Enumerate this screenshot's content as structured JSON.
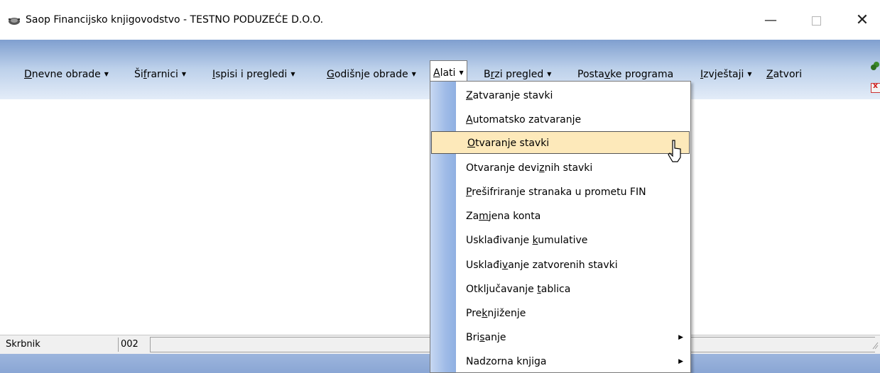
{
  "window": {
    "title": "Saop Financijsko knjigovodstvo - TESTNO PODUZEĆE D.O.O.",
    "min_glyph": "—",
    "close_glyph": "✕"
  },
  "menubar": {
    "caret": "▼",
    "items": [
      {
        "pre": "",
        "u": "D",
        "post": "nevne obrade",
        "has_caret": true
      },
      {
        "pre": "Ši",
        "u": "f",
        "post": "rarnici",
        "has_caret": true
      },
      {
        "pre": "",
        "u": "I",
        "post": "spisi i pregledi",
        "has_caret": true
      },
      {
        "pre": "",
        "u": "G",
        "post": "odišnje obrade",
        "has_caret": true
      },
      {
        "pre": "",
        "u": "A",
        "post": "lati",
        "has_caret": true
      },
      {
        "pre": "B",
        "u": "r",
        "post": "zi pregled",
        "has_caret": true
      },
      {
        "pre": "Posta",
        "u": "v",
        "post": "ke programa",
        "has_caret": false
      },
      {
        "pre": "",
        "u": "I",
        "post": "zvještaji",
        "has_caret": true
      },
      {
        "pre": "",
        "u": "Z",
        "post": "atvori",
        "has_caret": false
      }
    ]
  },
  "dropdown": {
    "submenu_arrow": "▶",
    "items": [
      {
        "pre": "",
        "u": "Z",
        "post": "atvaranje stavki"
      },
      {
        "pre": "",
        "u": "A",
        "post": "utomatsko zatvaranje"
      },
      {
        "pre": "",
        "u": "O",
        "post": "tvaranje stavki"
      },
      {
        "pre": "Otvaranje devi",
        "u": "z",
        "post": "nih stavki"
      },
      {
        "pre": "",
        "u": "P",
        "post": "rešifriranje stranaka u prometu FIN"
      },
      {
        "pre": "Za",
        "u": "m",
        "post": "jena konta"
      },
      {
        "pre": "Usklađivanje ",
        "u": "k",
        "post": "umulative"
      },
      {
        "pre": "Usklađi",
        "u": "v",
        "post": "anje zatvorenih stavki"
      },
      {
        "pre": "Otključavanje ",
        "u": "t",
        "post": "ablica"
      },
      {
        "pre": "Pre",
        "u": "k",
        "post": "njiženje"
      },
      {
        "pre": "Bri",
        "u": "s",
        "post": "anje"
      },
      {
        "pre": "Nadzorna knjiga",
        "u": "",
        "post": ""
      }
    ]
  },
  "statusbar": {
    "user": "Skrbnik",
    "code": "002"
  },
  "colors": {
    "menubar_top": "#7f9fcf",
    "menubar_bottom": "#e3ecf8",
    "highlight": "#fde9ba"
  }
}
